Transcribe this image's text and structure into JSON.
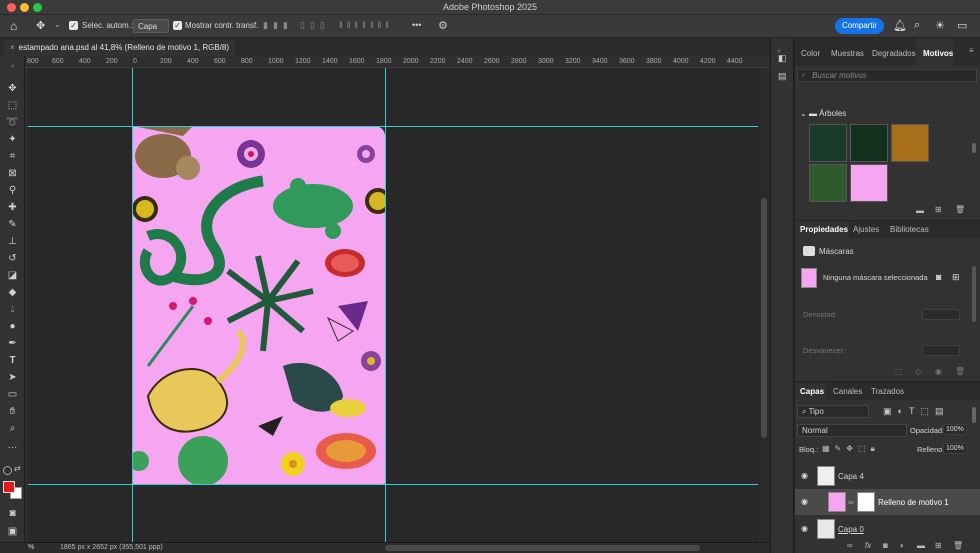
{
  "app": {
    "title": "Adobe Photoshop 2025",
    "share_label": "Compartir"
  },
  "options_bar": {
    "auto_select_label": "Selec. autom.:",
    "auto_select_value": "Capa",
    "show_transform_label": "Mostrar contr. transf.",
    "more_label": "•••"
  },
  "document": {
    "tab_title": "estampado ana.psd al 41,8% (Relleno de motivo 1, RGB/8)",
    "status_zoom": "%",
    "status_info": "1865 px x 2652 px (355,501 ppp)"
  },
  "ruler": {
    "ticks": [
      "800",
      "600",
      "400",
      "200",
      "0",
      "200",
      "400",
      "600",
      "800",
      "1000",
      "1200",
      "1400",
      "1600",
      "1800",
      "2000",
      "2200",
      "2400",
      "2600",
      "2800",
      "3000",
      "3200",
      "3400",
      "3600",
      "3800",
      "4000",
      "4200",
      "4400"
    ]
  },
  "patterns_panel": {
    "tabs": [
      "Color",
      "Muestras",
      "Degradados",
      "Motivos"
    ],
    "active_tab": "Motivos",
    "search_placeholder": "Buscar motivos",
    "group_name": "Árboles"
  },
  "properties_panel": {
    "tabs": [
      "Propiedades",
      "Ajustes",
      "Bibliotecas"
    ],
    "active_tab": "Propiedades",
    "section_label": "Máscaras",
    "mask_status": "Ninguna máscara seleccionada",
    "density_label": "Densidad:",
    "feather_label": "Desvanecer:"
  },
  "layers_panel": {
    "tabs": [
      "Capas",
      "Canales",
      "Trazados"
    ],
    "active_tab": "Capas",
    "filter_label": "Tipo",
    "blend_mode": "Normal",
    "opacity_label": "Opacidad:",
    "opacity_value": "100%",
    "lock_label": "Bloq.:",
    "fill_label": "Relleno:",
    "fill_value": "100%",
    "layers": [
      {
        "name": "Capa 4"
      },
      {
        "name": "Relleno de motivo 1"
      },
      {
        "name": "Capa 0"
      }
    ]
  },
  "colors": {
    "accent": "#1473e6",
    "guide": "#2fd0d8",
    "canvas_pink": "#f6a6f0",
    "foreground": "#e01a1a",
    "background": "#ffffff"
  }
}
